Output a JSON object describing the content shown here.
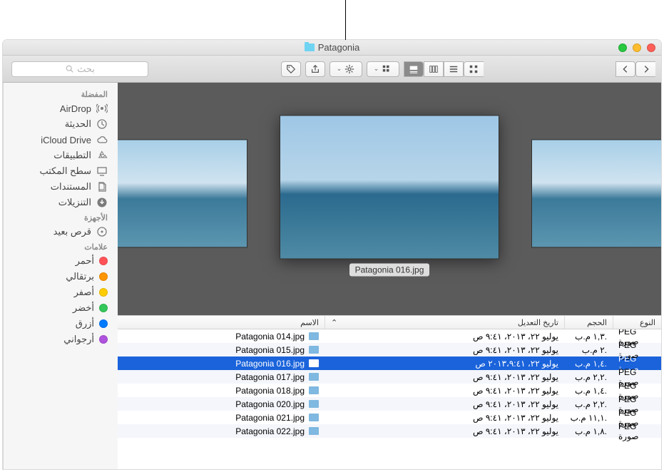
{
  "window": {
    "title": "Patagonia"
  },
  "toolbar": {
    "search_placeholder": "بحث"
  },
  "sidebar": {
    "favorites_heading": "المفضلة",
    "favorites": [
      {
        "label": "AirDrop",
        "icon": "airdrop"
      },
      {
        "label": "الحديثة",
        "icon": "clock"
      },
      {
        "label": "iCloud Drive",
        "icon": "cloud"
      },
      {
        "label": "التطبيقات",
        "icon": "apps"
      },
      {
        "label": "سطح المكتب",
        "icon": "desktop"
      },
      {
        "label": "المستندات",
        "icon": "documents"
      },
      {
        "label": "التنزيلات",
        "icon": "downloads"
      }
    ],
    "devices_heading": "الأجهزة",
    "devices": [
      {
        "label": "قرص بعيد",
        "icon": "disc"
      }
    ],
    "tags_heading": "علامات",
    "tags": [
      {
        "label": "أحمر",
        "color": "#ff5257"
      },
      {
        "label": "برتقالي",
        "color": "#ff9500"
      },
      {
        "label": "أصفر",
        "color": "#ffcc00"
      },
      {
        "label": "أخضر",
        "color": "#34c759"
      },
      {
        "label": "أزرق",
        "color": "#007aff"
      },
      {
        "label": "أرجواني",
        "color": "#af52de"
      }
    ]
  },
  "coverflow": {
    "selected_label": "Patagonia 016.jpg"
  },
  "columns": {
    "name": "الاسم",
    "date": "تاريخ التعديل",
    "size": "الحجم",
    "kind": "النوع"
  },
  "files": [
    {
      "name": "Patagonia 014.jpg",
      "date": "يوليو ٢٢، ٢٠١٣، ٩:٤١ ص",
      "size": "١,٣ م.ب.",
      "kind": "PEG صورة",
      "selected": false
    },
    {
      "name": "Patagonia 015.jpg",
      "date": "يوليو ٢٢، ٢٠١٣، ٩:٤١ ص",
      "size": "٢ م.ب.",
      "kind": "PEG صورة",
      "selected": false
    },
    {
      "name": "Patagonia 016.jpg",
      "date": "يوليو ٢٢، ٢٠١٣،٩:٤١ ص",
      "size": "١,٤ م.ب.",
      "kind": "PEG صورة",
      "selected": true
    },
    {
      "name": "Patagonia 017.jpg",
      "date": "يوليو ٢٢، ٢٠١٣، ٩:٤١ ص",
      "size": "٢,٢ م.ب.",
      "kind": "PEG صورة",
      "selected": false
    },
    {
      "name": "Patagonia 018.jpg",
      "date": "يوليو ٢٢، ٢٠١٣، ٩:٤١ ص",
      "size": "١,٤ م.ب.",
      "kind": "PEG صورة",
      "selected": false
    },
    {
      "name": "Patagonia 020.jpg",
      "date": "يوليو ٢٢، ٢٠١٣، ٩:٤١ ص",
      "size": "٢,٢ م.ب.",
      "kind": "PEG صورة",
      "selected": false
    },
    {
      "name": "Patagonia 021.jpg",
      "date": "يوليو ٢٢، ٢٠١٣، ٩:٤١ ص",
      "size": "١١,١ م.ب.",
      "kind": "PEG صورة",
      "selected": false
    },
    {
      "name": "Patagonia 022.jpg",
      "date": "يوليو ٢٢، ٢٠١٣، ٩:٤١ ص",
      "size": "١,٨ م.ب.",
      "kind": "PEG صورة",
      "selected": false
    }
  ]
}
